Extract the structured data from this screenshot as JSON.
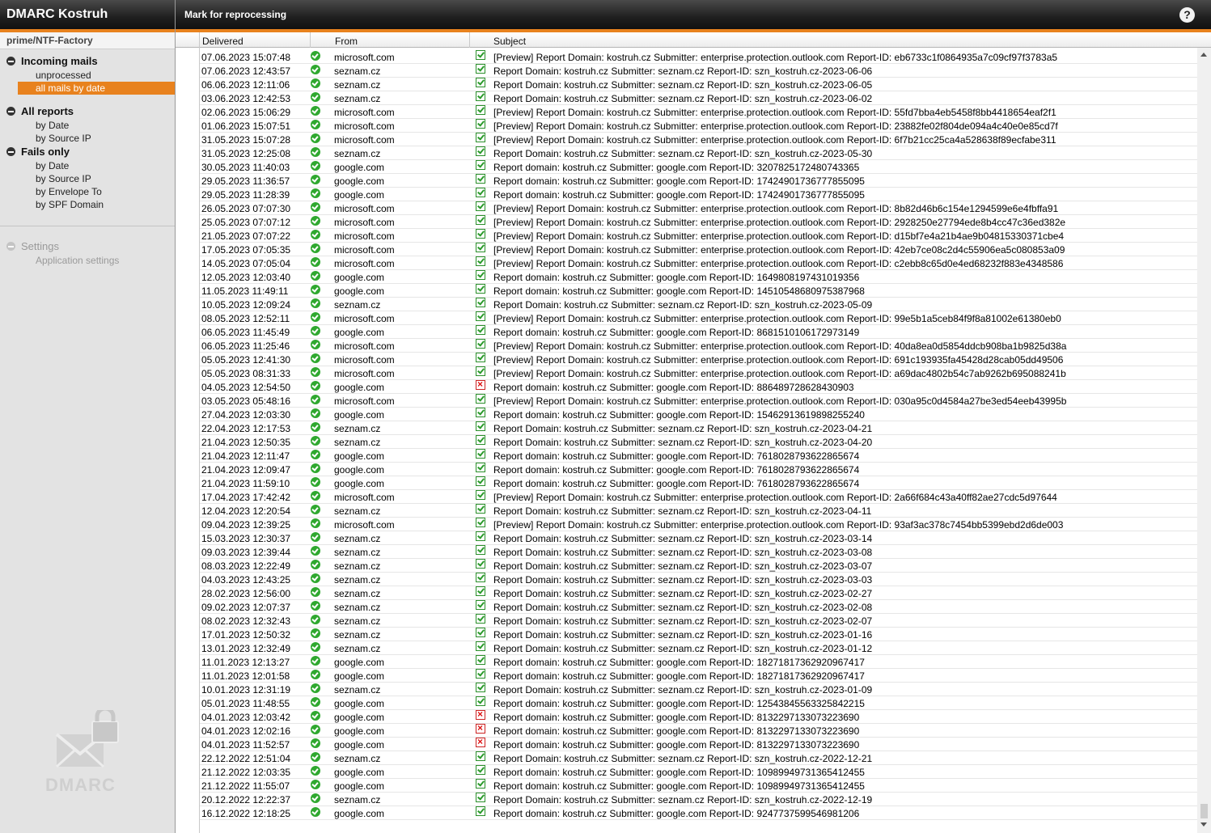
{
  "app": {
    "title": "DMARC Kostruh"
  },
  "sidebar": {
    "context": "prime/NTF-Factory",
    "incoming": {
      "title": "Incoming mails",
      "items": [
        "unprocessed",
        "all mails by date"
      ]
    },
    "all_reports": {
      "title": "All reports",
      "items": [
        "by Date",
        "by Source IP"
      ]
    },
    "fails_only": {
      "title": "Fails only",
      "items": [
        "by Date",
        "by Source IP",
        "by Envelope To",
        "by SPF Domain"
      ]
    },
    "settings": {
      "title": "Settings",
      "items": [
        "Application settings"
      ]
    },
    "logo_text": "DMARC"
  },
  "toolbar": {
    "mark_label": "Mark for reprocessing",
    "help_label": "?"
  },
  "grid": {
    "columns": [
      "Delivered",
      "From",
      "Subject"
    ],
    "rows": [
      {
        "date": "07.06.2023 15:07:48",
        "from": "microsoft.com",
        "ok": true,
        "subject": "[Preview] Report Domain: kostruh.cz Submitter: enterprise.protection.outlook.com Report-ID: eb6733c1f0864935a7c09cf97f3783a5"
      },
      {
        "date": "07.06.2023 12:43:57",
        "from": "seznam.cz",
        "ok": true,
        "subject": "Report Domain: kostruh.cz Submitter: seznam.cz Report-ID: szn_kostruh.cz-2023-06-06"
      },
      {
        "date": "06.06.2023 12:11:06",
        "from": "seznam.cz",
        "ok": true,
        "subject": "Report Domain: kostruh.cz Submitter: seznam.cz Report-ID: szn_kostruh.cz-2023-06-05"
      },
      {
        "date": "03.06.2023 12:42:53",
        "from": "seznam.cz",
        "ok": true,
        "subject": "Report Domain: kostruh.cz Submitter: seznam.cz Report-ID: szn_kostruh.cz-2023-06-02"
      },
      {
        "date": "02.06.2023 15:06:29",
        "from": "microsoft.com",
        "ok": true,
        "subject": "[Preview] Report Domain: kostruh.cz Submitter: enterprise.protection.outlook.com Report-ID: 55fd7bba4eb5458f8bb4418654eaf2f1"
      },
      {
        "date": "01.06.2023 15:07:51",
        "from": "microsoft.com",
        "ok": true,
        "subject": "[Preview] Report Domain: kostruh.cz Submitter: enterprise.protection.outlook.com Report-ID: 23882fe02f804de094a4c40e0e85cd7f"
      },
      {
        "date": "31.05.2023 15:07:28",
        "from": "microsoft.com",
        "ok": true,
        "subject": "[Preview] Report Domain: kostruh.cz Submitter: enterprise.protection.outlook.com Report-ID: 6f7b21cc25ca4a528638f89ecfabe311"
      },
      {
        "date": "31.05.2023 12:25:08",
        "from": "seznam.cz",
        "ok": true,
        "subject": "Report Domain: kostruh.cz Submitter: seznam.cz Report-ID: szn_kostruh.cz-2023-05-30"
      },
      {
        "date": "30.05.2023 11:40:03",
        "from": "google.com",
        "ok": true,
        "subject": "Report domain: kostruh.cz Submitter: google.com Report-ID: 3207825172480743365"
      },
      {
        "date": "29.05.2023 11:36:57",
        "from": "google.com",
        "ok": true,
        "subject": "Report domain: kostruh.cz Submitter: google.com Report-ID: 17424901736777855095"
      },
      {
        "date": "29.05.2023 11:28:39",
        "from": "google.com",
        "ok": true,
        "subject": "Report domain: kostruh.cz Submitter: google.com Report-ID: 17424901736777855095"
      },
      {
        "date": "26.05.2023 07:07:30",
        "from": "microsoft.com",
        "ok": true,
        "subject": "[Preview] Report Domain: kostruh.cz Submitter: enterprise.protection.outlook.com Report-ID: 8b82d46b6c154e1294599e6e4fbffa91"
      },
      {
        "date": "25.05.2023 07:07:12",
        "from": "microsoft.com",
        "ok": true,
        "subject": "[Preview] Report Domain: kostruh.cz Submitter: enterprise.protection.outlook.com Report-ID: 2928250e27794ede8b4cc47c36ed382e"
      },
      {
        "date": "21.05.2023 07:07:22",
        "from": "microsoft.com",
        "ok": true,
        "subject": "[Preview] Report Domain: kostruh.cz Submitter: enterprise.protection.outlook.com Report-ID: d15bf7e4a21b4ae9b04815330371cbe4"
      },
      {
        "date": "17.05.2023 07:05:35",
        "from": "microsoft.com",
        "ok": true,
        "subject": "[Preview] Report Domain: kostruh.cz Submitter: enterprise.protection.outlook.com Report-ID: 42eb7ce08c2d4c55906ea5c080853a09"
      },
      {
        "date": "14.05.2023 07:05:04",
        "from": "microsoft.com",
        "ok": true,
        "subject": "[Preview] Report Domain: kostruh.cz Submitter: enterprise.protection.outlook.com Report-ID: c2ebb8c65d0e4ed68232f883e4348586"
      },
      {
        "date": "12.05.2023 12:03:40",
        "from": "google.com",
        "ok": true,
        "subject": "Report domain: kostruh.cz Submitter: google.com Report-ID: 1649808197431019356"
      },
      {
        "date": "11.05.2023 11:49:11",
        "from": "google.com",
        "ok": true,
        "subject": "Report domain: kostruh.cz Submitter: google.com Report-ID: 14510548680975387968"
      },
      {
        "date": "10.05.2023 12:09:24",
        "from": "seznam.cz",
        "ok": true,
        "subject": "Report Domain: kostruh.cz Submitter: seznam.cz Report-ID: szn_kostruh.cz-2023-05-09"
      },
      {
        "date": "08.05.2023 12:52:11",
        "from": "microsoft.com",
        "ok": true,
        "subject": "[Preview] Report Domain: kostruh.cz Submitter: enterprise.protection.outlook.com Report-ID: 99e5b1a5ceb84f9f8a81002e61380eb0"
      },
      {
        "date": "06.05.2023 11:45:49",
        "from": "google.com",
        "ok": true,
        "subject": "Report domain: kostruh.cz Submitter: google.com Report-ID: 8681510106172973149"
      },
      {
        "date": "06.05.2023 11:25:46",
        "from": "microsoft.com",
        "ok": true,
        "subject": "[Preview] Report Domain: kostruh.cz Submitter: enterprise.protection.outlook.com Report-ID: 40da8ea0d5854ddcb908ba1b9825d38a"
      },
      {
        "date": "05.05.2023 12:41:30",
        "from": "microsoft.com",
        "ok": true,
        "subject": "[Preview] Report Domain: kostruh.cz Submitter: enterprise.protection.outlook.com Report-ID: 691c193935fa45428d28cab05dd49506"
      },
      {
        "date": "05.05.2023 08:31:33",
        "from": "microsoft.com",
        "ok": true,
        "subject": "[Preview] Report Domain: kostruh.cz Submitter: enterprise.protection.outlook.com Report-ID: a69dac4802b54c7ab9262b695088241b"
      },
      {
        "date": "04.05.2023 12:54:50",
        "from": "google.com",
        "ok": false,
        "subject": "Report domain: kostruh.cz Submitter: google.com Report-ID: 886489728628430903"
      },
      {
        "date": "03.05.2023 05:48:16",
        "from": "microsoft.com",
        "ok": true,
        "subject": "[Preview] Report Domain: kostruh.cz Submitter: enterprise.protection.outlook.com Report-ID: 030a95c0d4584a27be3ed54eeb43995b"
      },
      {
        "date": "27.04.2023 12:03:30",
        "from": "google.com",
        "ok": true,
        "subject": "Report domain: kostruh.cz Submitter: google.com Report-ID: 15462913619898255240"
      },
      {
        "date": "22.04.2023 12:17:53",
        "from": "seznam.cz",
        "ok": true,
        "subject": "Report Domain: kostruh.cz Submitter: seznam.cz Report-ID: szn_kostruh.cz-2023-04-21"
      },
      {
        "date": "21.04.2023 12:50:35",
        "from": "seznam.cz",
        "ok": true,
        "subject": "Report Domain: kostruh.cz Submitter: seznam.cz Report-ID: szn_kostruh.cz-2023-04-20"
      },
      {
        "date": "21.04.2023 12:11:47",
        "from": "google.com",
        "ok": true,
        "subject": "Report domain: kostruh.cz Submitter: google.com Report-ID: 7618028793622865674"
      },
      {
        "date": "21.04.2023 12:09:47",
        "from": "google.com",
        "ok": true,
        "subject": "Report domain: kostruh.cz Submitter: google.com Report-ID: 7618028793622865674"
      },
      {
        "date": "21.04.2023 11:59:10",
        "from": "google.com",
        "ok": true,
        "subject": "Report domain: kostruh.cz Submitter: google.com Report-ID: 7618028793622865674"
      },
      {
        "date": "17.04.2023 17:42:42",
        "from": "microsoft.com",
        "ok": true,
        "subject": "[Preview] Report Domain: kostruh.cz Submitter: enterprise.protection.outlook.com Report-ID: 2a66f684c43a40ff82ae27cdc5d97644"
      },
      {
        "date": "12.04.2023 12:20:54",
        "from": "seznam.cz",
        "ok": true,
        "subject": "Report Domain: kostruh.cz Submitter: seznam.cz Report-ID: szn_kostruh.cz-2023-04-11"
      },
      {
        "date": "09.04.2023 12:39:25",
        "from": "microsoft.com",
        "ok": true,
        "subject": "[Preview] Report Domain: kostruh.cz Submitter: enterprise.protection.outlook.com Report-ID: 93af3ac378c7454bb5399ebd2d6de003"
      },
      {
        "date": "15.03.2023 12:30:37",
        "from": "seznam.cz",
        "ok": true,
        "subject": "Report Domain: kostruh.cz Submitter: seznam.cz Report-ID: szn_kostruh.cz-2023-03-14"
      },
      {
        "date": "09.03.2023 12:39:44",
        "from": "seznam.cz",
        "ok": true,
        "subject": "Report Domain: kostruh.cz Submitter: seznam.cz Report-ID: szn_kostruh.cz-2023-03-08"
      },
      {
        "date": "08.03.2023 12:22:49",
        "from": "seznam.cz",
        "ok": true,
        "subject": "Report Domain: kostruh.cz Submitter: seznam.cz Report-ID: szn_kostruh.cz-2023-03-07"
      },
      {
        "date": "04.03.2023 12:43:25",
        "from": "seznam.cz",
        "ok": true,
        "subject": "Report Domain: kostruh.cz Submitter: seznam.cz Report-ID: szn_kostruh.cz-2023-03-03"
      },
      {
        "date": "28.02.2023 12:56:00",
        "from": "seznam.cz",
        "ok": true,
        "subject": "Report Domain: kostruh.cz Submitter: seznam.cz Report-ID: szn_kostruh.cz-2023-02-27"
      },
      {
        "date": "09.02.2023 12:07:37",
        "from": "seznam.cz",
        "ok": true,
        "subject": "Report Domain: kostruh.cz Submitter: seznam.cz Report-ID: szn_kostruh.cz-2023-02-08"
      },
      {
        "date": "08.02.2023 12:32:43",
        "from": "seznam.cz",
        "ok": true,
        "subject": "Report Domain: kostruh.cz Submitter: seznam.cz Report-ID: szn_kostruh.cz-2023-02-07"
      },
      {
        "date": "17.01.2023 12:50:32",
        "from": "seznam.cz",
        "ok": true,
        "subject": "Report Domain: kostruh.cz Submitter: seznam.cz Report-ID: szn_kostruh.cz-2023-01-16"
      },
      {
        "date": "13.01.2023 12:32:49",
        "from": "seznam.cz",
        "ok": true,
        "subject": "Report Domain: kostruh.cz Submitter: seznam.cz Report-ID: szn_kostruh.cz-2023-01-12"
      },
      {
        "date": "11.01.2023 12:13:27",
        "from": "google.com",
        "ok": true,
        "subject": "Report domain: kostruh.cz Submitter: google.com Report-ID: 18271817362920967417"
      },
      {
        "date": "11.01.2023 12:01:58",
        "from": "google.com",
        "ok": true,
        "subject": "Report domain: kostruh.cz Submitter: google.com Report-ID: 18271817362920967417"
      },
      {
        "date": "10.01.2023 12:31:19",
        "from": "seznam.cz",
        "ok": true,
        "subject": "Report Domain: kostruh.cz Submitter: seznam.cz Report-ID: szn_kostruh.cz-2023-01-09"
      },
      {
        "date": "05.01.2023 11:48:55",
        "from": "google.com",
        "ok": true,
        "subject": "Report domain: kostruh.cz Submitter: google.com Report-ID: 12543845563325842215"
      },
      {
        "date": "04.01.2023 12:03:42",
        "from": "google.com",
        "ok": false,
        "subject": "Report domain: kostruh.cz Submitter: google.com Report-ID: 8132297133073223690"
      },
      {
        "date": "04.01.2023 12:02:16",
        "from": "google.com",
        "ok": false,
        "subject": "Report domain: kostruh.cz Submitter: google.com Report-ID: 8132297133073223690"
      },
      {
        "date": "04.01.2023 11:52:57",
        "from": "google.com",
        "ok": false,
        "subject": "Report domain: kostruh.cz Submitter: google.com Report-ID: 8132297133073223690"
      },
      {
        "date": "22.12.2022 12:51:04",
        "from": "seznam.cz",
        "ok": true,
        "subject": "Report Domain: kostruh.cz Submitter: seznam.cz Report-ID: szn_kostruh.cz-2022-12-21"
      },
      {
        "date": "21.12.2022 12:03:35",
        "from": "google.com",
        "ok": true,
        "subject": "Report domain: kostruh.cz Submitter: google.com Report-ID: 10989949731365412455"
      },
      {
        "date": "21.12.2022 11:55:07",
        "from": "google.com",
        "ok": true,
        "subject": "Report domain: kostruh.cz Submitter: google.com Report-ID: 10989949731365412455"
      },
      {
        "date": "20.12.2022 12:22:37",
        "from": "seznam.cz",
        "ok": true,
        "subject": "Report Domain: kostruh.cz Submitter: seznam.cz Report-ID: szn_kostruh.cz-2022-12-19"
      },
      {
        "date": "16.12.2022 12:18:25",
        "from": "google.com",
        "ok": true,
        "subject": "Report domain: kostruh.cz Submitter: google.com Report-ID: 9247737599546981206"
      }
    ]
  },
  "colors": {
    "accent": "#e8821e",
    "ok": "#2fa82f",
    "fail": "#dd1111"
  }
}
